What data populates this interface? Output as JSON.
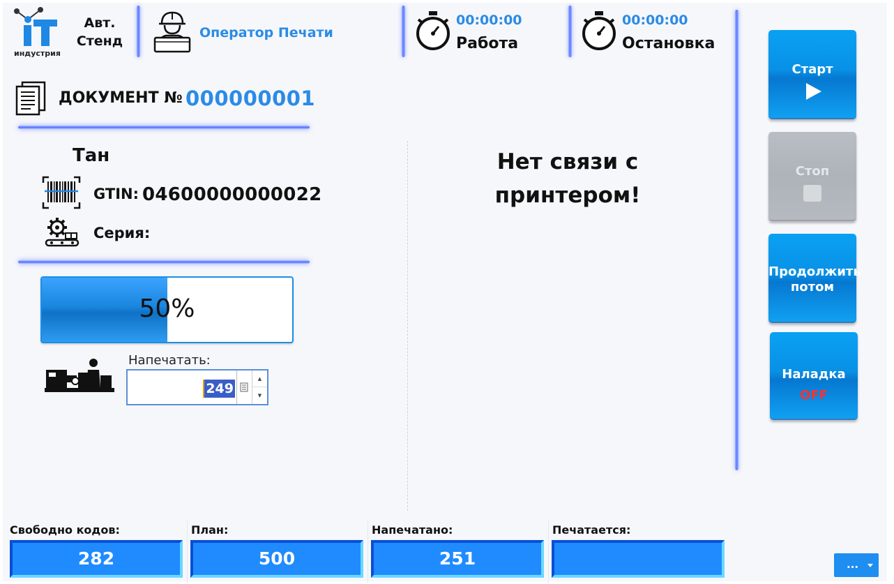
{
  "header": {
    "logo_text": "iT",
    "logo_subtitle": "индустрия",
    "stand_line1": "Авт.",
    "stand_line2": "Стенд",
    "operator_label": "Оператор Печати",
    "timers": [
      {
        "time": "00:00:00",
        "label": "Работа",
        "icon": "stopwatch-icon"
      },
      {
        "time": "00:00:00",
        "label": "Остановка",
        "icon": "stopwatch-icon"
      }
    ]
  },
  "document": {
    "label": "ДОКУМЕНТ №",
    "number": "000000001"
  },
  "product": {
    "name": "Тан",
    "gtin_label": "GTIN:",
    "gtin_value": "04600000000022",
    "series_label": "Серия:",
    "series_value": ""
  },
  "progress": {
    "value": 0.5,
    "text": "50%"
  },
  "print_input": {
    "label": "Напечатать:",
    "value": "249"
  },
  "status_message": {
    "line1": "Нет связи с",
    "line2": "принтером!"
  },
  "buttons": {
    "start": "Старт",
    "stop": "Стоп",
    "continue_line1": "Продолжить",
    "continue_line2": "потом",
    "setup": "Наладка",
    "setup_state": "OFF"
  },
  "footer": {
    "free_codes_label": "Свободно кодов:",
    "free_codes_value": "282",
    "plan_label": "План:",
    "plan_value": "500",
    "printed_label": "Напечатано:",
    "printed_value": "251",
    "printing_label": "Печатается:",
    "printing_value": "",
    "menu_label": "..."
  },
  "colors": {
    "accent_blue": "#2b8be6",
    "button_blue": "#0891e6",
    "footer_box": "#1f8bff",
    "glow_line": "#4d6cff",
    "off_red": "#ff3030"
  }
}
